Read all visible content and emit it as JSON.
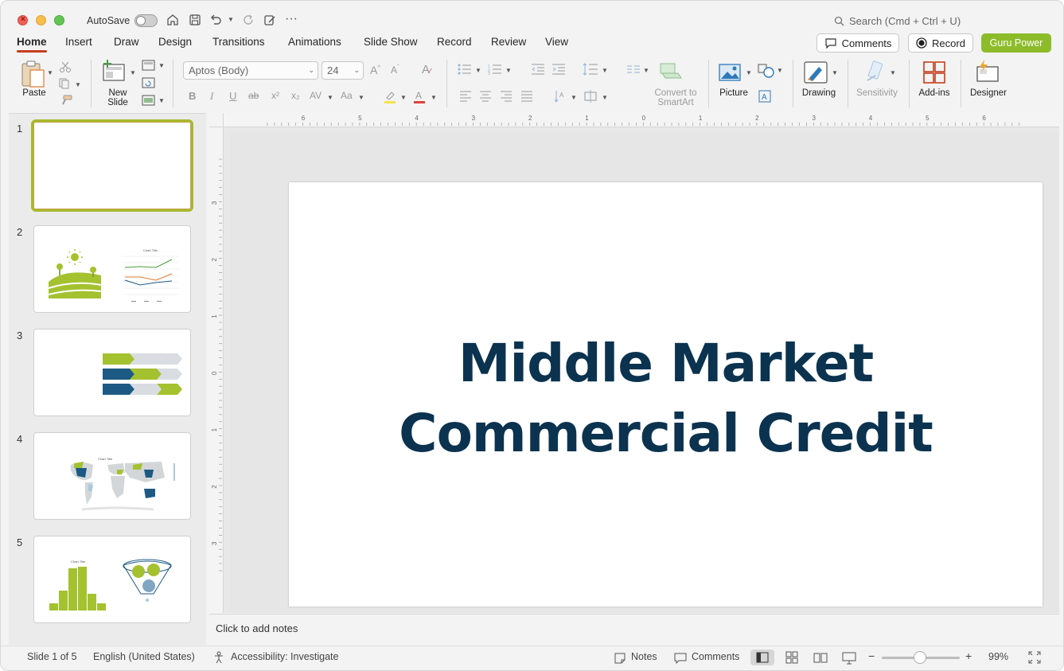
{
  "titlebar": {
    "autosave_label": "AutoSave",
    "autosave_on": false,
    "search_placeholder": "Search (Cmd + Ctrl + U)"
  },
  "tabs": [
    "Home",
    "Insert",
    "Draw",
    "Design",
    "Transitions",
    "Animations",
    "Slide Show",
    "Record",
    "Review",
    "View"
  ],
  "active_tab": "Home",
  "top_right": {
    "comments_label": "Comments",
    "record_label": "Record",
    "guru_label": "Guru Power",
    "guru_color": "#8cbc2a"
  },
  "ribbon": {
    "paste_label": "Paste",
    "new_slide_label": "New Slide",
    "font_name": "Aptos (Body)",
    "font_size": "24",
    "convert_smartart_label": "Convert to SmartArt",
    "picture_label": "Picture",
    "drawing_label": "Drawing",
    "sensitivity_label": "Sensitivity",
    "addins_label": "Add-ins",
    "designer_label": "Designer",
    "format_glyphs": {
      "bold": "B",
      "italic": "I",
      "underline": "U",
      "strike": "ab",
      "superscript": "x²",
      "subscript": "x₂",
      "spacing": "AV",
      "case": "Aa",
      "grow": "A^",
      "shrink": "Aˇ"
    }
  },
  "slides_pane": {
    "numbers": [
      "1",
      "2",
      "3",
      "4",
      "5"
    ],
    "selected": 1,
    "thumb2_chart_title": "Chart Title",
    "thumb4_chart_title": "Chart Title",
    "thumb5_chart_title": "Chart Title"
  },
  "ruler": {
    "h_labels": [
      "6",
      "5",
      "4",
      "3",
      "2",
      "1",
      "0",
      "1",
      "2",
      "3",
      "4",
      "5",
      "6"
    ],
    "v_labels": [
      "3",
      "2",
      "1",
      "0",
      "1",
      "2",
      "3"
    ]
  },
  "slide": {
    "title_line1": "Middle Market",
    "title_line2": "Commercial Credit",
    "title_color": "#0b3350"
  },
  "notes_placeholder": "Click to add notes",
  "statusbar": {
    "slide_info": "Slide 1 of 5",
    "language": "English (United States)",
    "accessibility": "Accessibility: Investigate",
    "notes_label": "Notes",
    "comments_label": "Comments",
    "zoom_minus": "−",
    "zoom_plus": "+",
    "zoom_level": "99%"
  },
  "colors": {
    "accent_red": "#c43e1c",
    "lime": "#a4c12f",
    "navy": "#1c5a84",
    "light_gray": "#d9dde2"
  }
}
